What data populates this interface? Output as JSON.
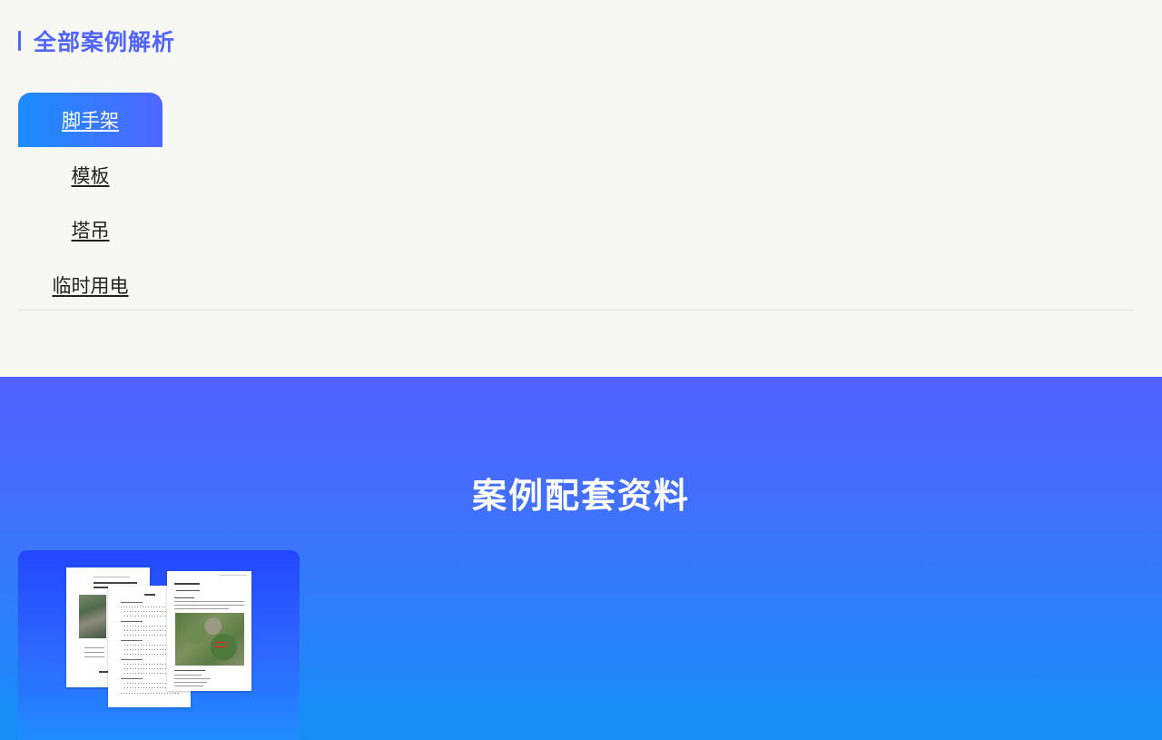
{
  "cases_section": {
    "heading": "全部案例解析",
    "accent_color": "#5166ff",
    "categories": [
      {
        "label": "脚手架",
        "active": true
      },
      {
        "label": "模板",
        "active": false
      },
      {
        "label": "塔吊",
        "active": false
      },
      {
        "label": "临时用电",
        "active": false
      }
    ]
  },
  "materials_section": {
    "title": "案例配套资料",
    "card": {
      "icon": "document-preview-icon"
    }
  }
}
